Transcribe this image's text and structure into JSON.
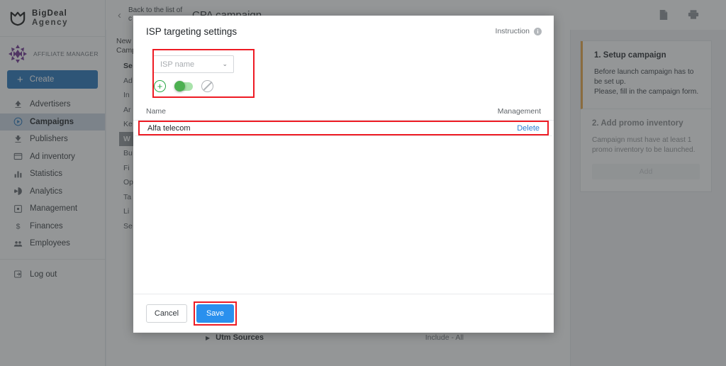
{
  "brand": {
    "line1": "BigDeal",
    "line2": "Agency"
  },
  "user": {
    "role": "AFFILIATE MANAGER"
  },
  "sidebar": {
    "create_label": "Create",
    "items": [
      {
        "label": "Advertisers",
        "icon": "upload-icon",
        "active": false
      },
      {
        "label": "Campaigns",
        "icon": "play-circle-icon",
        "active": true
      },
      {
        "label": "Publishers",
        "icon": "download-icon",
        "active": false
      },
      {
        "label": "Ad inventory",
        "icon": "window-icon",
        "active": false
      },
      {
        "label": "Statistics",
        "icon": "bar-chart-icon",
        "active": false
      },
      {
        "label": "Analytics",
        "icon": "pie-chart-icon",
        "active": false
      },
      {
        "label": "Management",
        "icon": "settings-square-icon",
        "active": false
      },
      {
        "label": "Finances",
        "icon": "dollar-icon",
        "active": false
      },
      {
        "label": "Employees",
        "icon": "people-icon",
        "active": false
      }
    ],
    "logout_label": "Log out"
  },
  "topbar": {
    "back_label": "Back to the list of c",
    "page_title": "CPA campaign"
  },
  "background_form": {
    "heading": "New\nCampa",
    "items": [
      "Se",
      "Ad",
      "In",
      "Ar",
      "Ke",
      "W",
      "Bu",
      "Fi",
      "Op",
      "Ta",
      "Li",
      "Se"
    ],
    "selected_index": 5
  },
  "utm": {
    "caret": "▶",
    "label": "Utm Sources",
    "value": "Include - All"
  },
  "helper": {
    "steps": [
      {
        "title": "1. Setup campaign",
        "body": "Before launch campaign has to be set up.\nPlease, fill in the campaign form.",
        "active": true
      },
      {
        "title": "2. Add promo inventory",
        "body": "Campaign must have at least 1 promo inventory to be launched.",
        "button": "Add",
        "active": false
      }
    ]
  },
  "modal": {
    "title": "ISP targeting settings",
    "instruction_label": "Instruction",
    "info_glyph": "i",
    "isp_select": {
      "placeholder": "ISP name",
      "value": "",
      "caret": "⌄"
    },
    "mode_controls": [
      {
        "name": "add-icon",
        "glyph": "+"
      },
      {
        "name": "include-toggle",
        "state": "on"
      },
      {
        "name": "exclude-icon",
        "glyph": "⊘"
      }
    ],
    "table": {
      "columns": [
        "Name",
        "Management"
      ],
      "rows": [
        {
          "name": "Alfa telecom",
          "action": "Delete"
        }
      ]
    },
    "footer": {
      "cancel": "Cancel",
      "save": "Save"
    }
  },
  "colors": {
    "accent_blue": "#1e6fb8",
    "save_blue": "#2a90ee",
    "highlight_red": "#ee1b24",
    "toggle_green": "#4cb050",
    "step_orange": "#e8a33d"
  }
}
